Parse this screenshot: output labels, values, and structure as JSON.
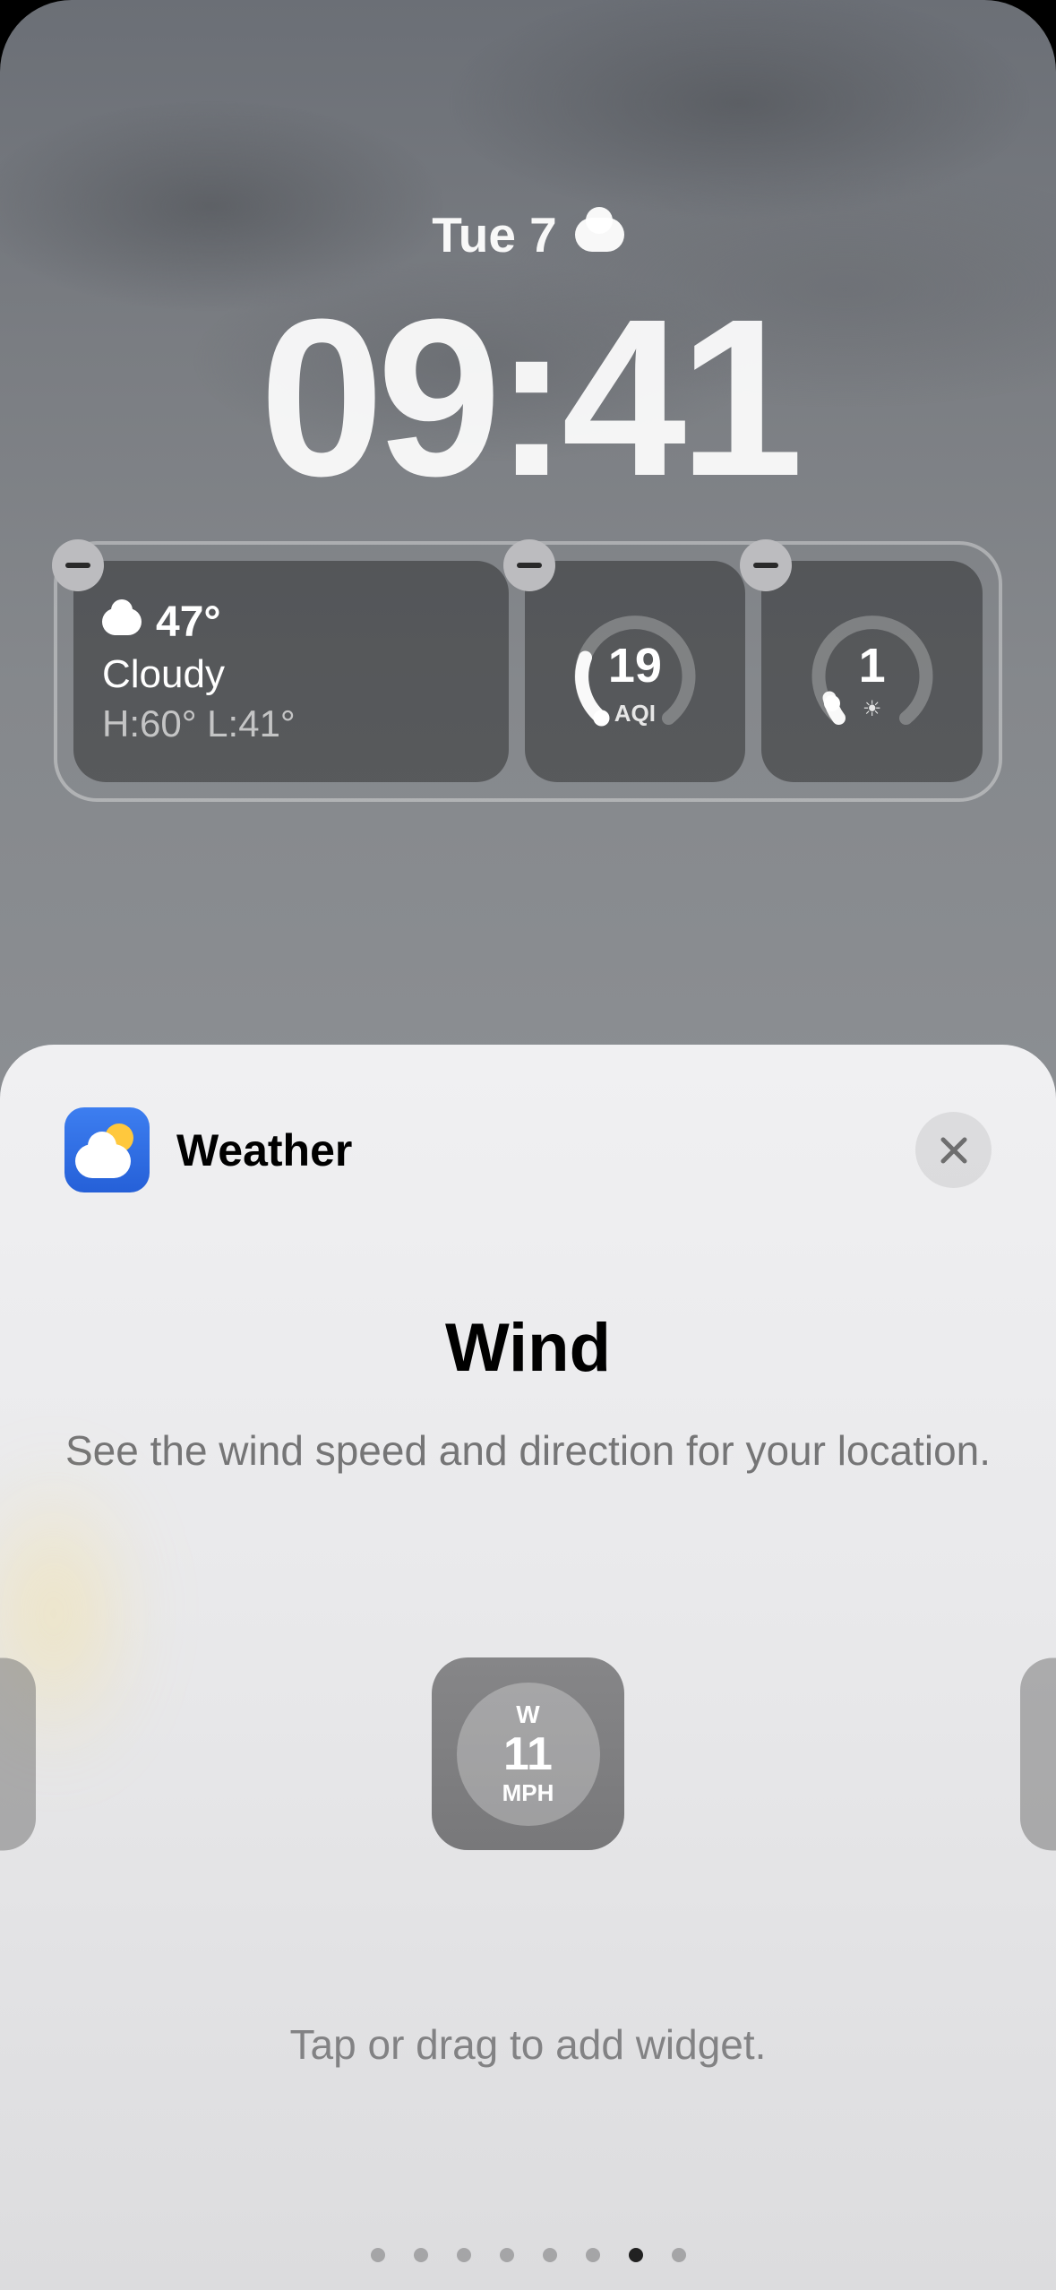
{
  "lock_screen": {
    "date": "Tue 7",
    "time": "09:41",
    "widgets": {
      "weather": {
        "temp": "47°",
        "condition": "Cloudy",
        "hilo": "H:60° L:41°"
      },
      "aqi": {
        "value": "19",
        "label": "AQI"
      },
      "uv": {
        "value": "1"
      }
    }
  },
  "sheet": {
    "app_name": "Weather",
    "widget_title": "Wind",
    "widget_desc": "See the wind speed and direction for your location.",
    "preview": {
      "direction": "W",
      "speed": "11",
      "unit": "MPH"
    },
    "hint": "Tap or drag to add widget.",
    "page_count": 8,
    "active_page": 7
  }
}
